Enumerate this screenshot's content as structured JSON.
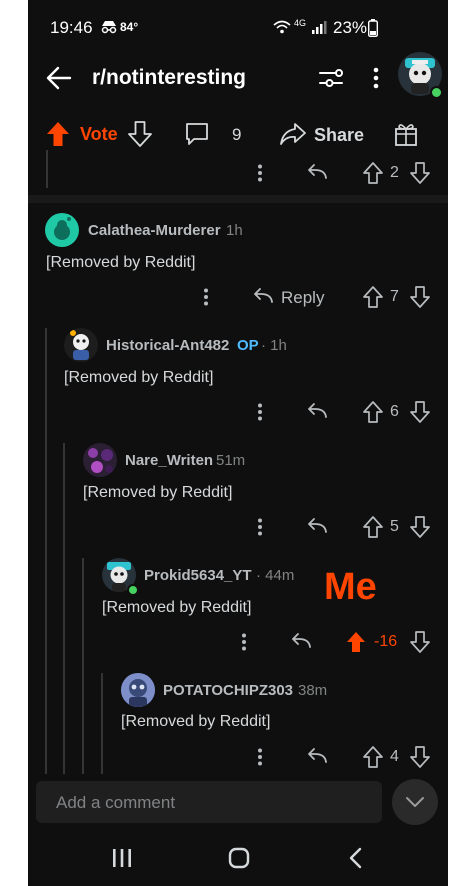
{
  "status": {
    "time": "19:46",
    "temp": "84°",
    "network": "4G",
    "battery": "23%"
  },
  "header": {
    "title": "r/notinteresting"
  },
  "post_actions": {
    "vote_label": "Vote",
    "comments_count": "9",
    "share_label": "Share"
  },
  "partial_comment": {
    "score": "2"
  },
  "comments": [
    {
      "user": "Calathea-Murderer",
      "time": "1h",
      "body": "[Removed by Reddit]",
      "reply_label": "Reply",
      "score": "7"
    },
    {
      "user": "Historical-Ant482",
      "op": "OP",
      "time": "· 1h",
      "body": "[Removed by Reddit]",
      "score": "6"
    },
    {
      "user": "Nare_Writen",
      "time": "51m",
      "body": "[Removed by Reddit]",
      "score": "5"
    },
    {
      "user": "Prokid5634_YT",
      "time": "· 44m",
      "body": "[Removed by Reddit]",
      "score": "-16",
      "annotation": "Me"
    },
    {
      "user": "POTATOCHIPZ303",
      "time": "38m",
      "body": "[Removed by Reddit]",
      "score": "4"
    }
  ],
  "composer": {
    "placeholder": "Add a comment"
  },
  "colors": {
    "accent": "#ff4500",
    "background": "#0f0f0f",
    "surface": "#1a1a1b"
  }
}
